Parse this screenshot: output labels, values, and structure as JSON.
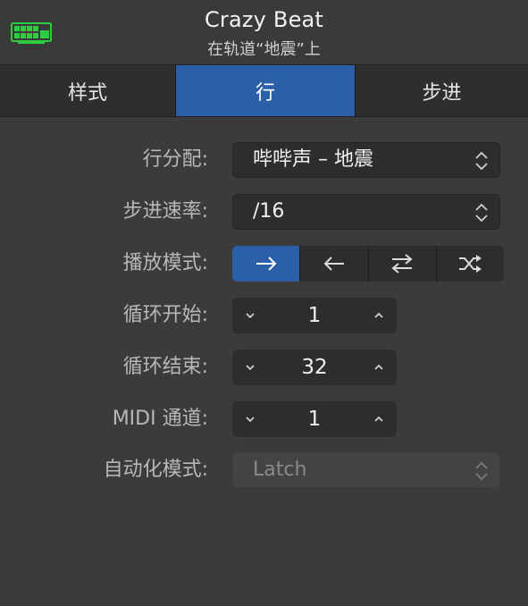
{
  "header": {
    "title": "Crazy Beat",
    "subtitle": "在轨道“地震”上",
    "icon": "step-sequencer-icon",
    "icon_color": "#2ecc40"
  },
  "tabs": [
    {
      "label": "样式",
      "selected": false
    },
    {
      "label": "行",
      "selected": true
    },
    {
      "label": "步进",
      "selected": false
    }
  ],
  "colors": {
    "accent": "#2b5fa8",
    "panel": "#3b3b3b"
  },
  "fields": {
    "row_assignment": {
      "label": "行分配:",
      "value": "哔哔声 – 地震"
    },
    "step_rate": {
      "label": "步进速率:",
      "value": "/16"
    },
    "playback_mode": {
      "label": "播放模式:",
      "options": [
        "forward-arrow-icon",
        "backward-arrow-icon",
        "ping-pong-arrows-icon",
        "shuffle-icon"
      ],
      "selected": "forward-arrow-icon"
    },
    "loop_start": {
      "label": "循环开始:",
      "value": "1"
    },
    "loop_end": {
      "label": "循环结束:",
      "value": "32"
    },
    "midi_channel": {
      "label": "MIDI 通道:",
      "value": "1"
    },
    "automation_mode": {
      "label": "自动化模式:",
      "value": "Latch",
      "disabled": true
    }
  }
}
